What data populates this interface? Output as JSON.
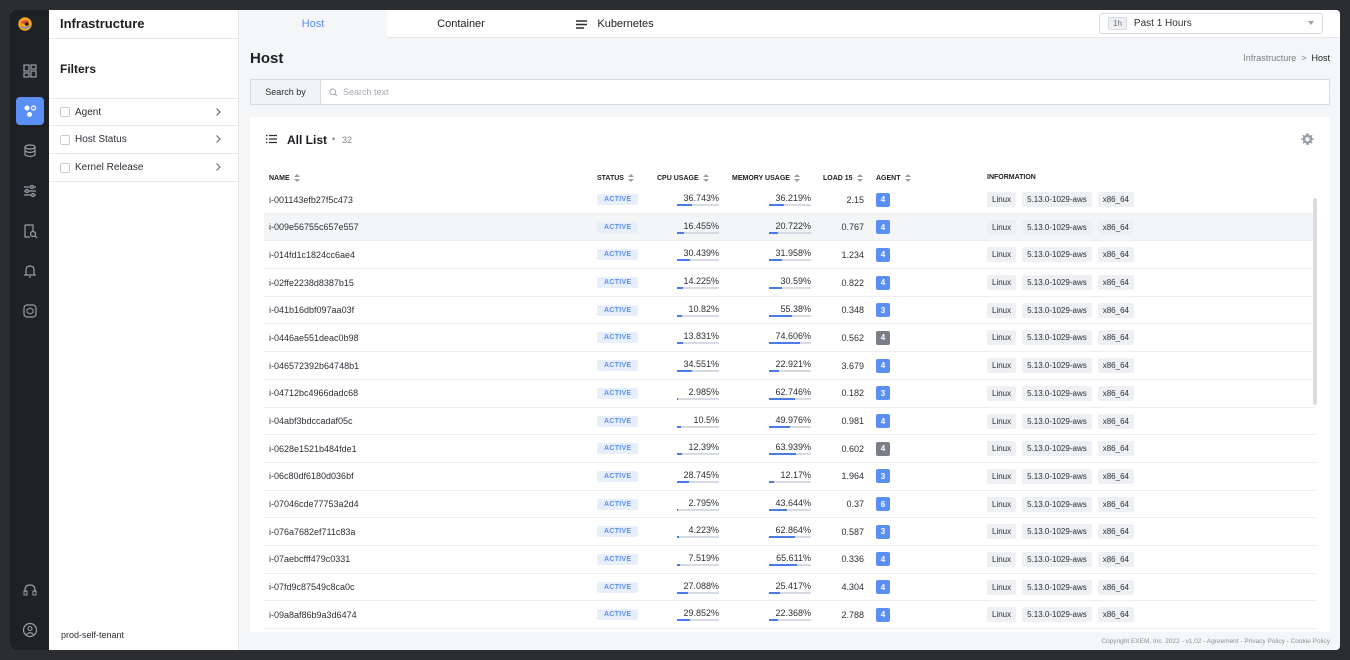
{
  "app": {
    "title": "Infrastructure"
  },
  "filters": {
    "title": "Filters",
    "items": [
      {
        "label": "Agent"
      },
      {
        "label": "Host Status"
      },
      {
        "label": "Kernel Release"
      }
    ],
    "tenant": "prod-self-tenant"
  },
  "tabs": [
    {
      "label": "Host",
      "active": true
    },
    {
      "label": "Container"
    },
    {
      "label": "Kubernetes"
    }
  ],
  "time": {
    "badge": "1h",
    "value": "Past 1 Hours"
  },
  "page": {
    "title": "Host"
  },
  "breadcrumb": {
    "parent": "Infrastructure",
    "separator": ">",
    "current": "Host"
  },
  "search": {
    "by_label": "Search by",
    "placeholder": "Search text",
    "value": ""
  },
  "list": {
    "title": "All List",
    "dot": "•",
    "count": "32"
  },
  "columns": {
    "name": "NAME",
    "status": "STATUS",
    "cpu": "CPU USAGE",
    "memory": "MEMORY USAGE",
    "load": "LOAD 15",
    "agent": "AGENT",
    "info": "INFORMATION"
  },
  "rows": [
    {
      "name": "i-001143efb27f5c473",
      "status": "ACTIVE",
      "cpu": "36.743%",
      "cpu_pct": 36.743,
      "mem": "36.219%",
      "mem_pct": 36.219,
      "load": "2.15",
      "agent": "4"
    },
    {
      "name": "i-009e56755c657e557",
      "status": "ACTIVE",
      "cpu": "16.455%",
      "cpu_pct": 16.455,
      "mem": "20.722%",
      "mem_pct": 20.722,
      "load": "0.767",
      "agent": "4"
    },
    {
      "name": "i-014fd1c1824cc6ae4",
      "status": "ACTIVE",
      "cpu": "30.439%",
      "cpu_pct": 30.439,
      "mem": "31.958%",
      "mem_pct": 31.958,
      "load": "1.234",
      "agent": "4"
    },
    {
      "name": "i-02ffe2238d8387b15",
      "status": "ACTIVE",
      "cpu": "14.225%",
      "cpu_pct": 14.225,
      "mem": "30.59%",
      "mem_pct": 30.59,
      "load": "0.822",
      "agent": "4"
    },
    {
      "name": "i-041b16dbf097aa03f",
      "status": "ACTIVE",
      "cpu": "10.82%",
      "cpu_pct": 10.82,
      "mem": "55.38%",
      "mem_pct": 55.38,
      "load": "0.348",
      "agent": "3"
    },
    {
      "name": "i-0446ae551deac0b98",
      "status": "ACTIVE",
      "cpu": "13.831%",
      "cpu_pct": 13.831,
      "mem": "74.606%",
      "mem_pct": 74.606,
      "load": "0.562",
      "agent": "4",
      "agent_grey": true
    },
    {
      "name": "i-046572392b64748b1",
      "status": "ACTIVE",
      "cpu": "34.551%",
      "cpu_pct": 34.551,
      "mem": "22.921%",
      "mem_pct": 22.921,
      "load": "3.679",
      "agent": "4"
    },
    {
      "name": "i-04712bc4966dadc68",
      "status": "ACTIVE",
      "cpu": "2.985%",
      "cpu_pct": 2.985,
      "mem": "62.746%",
      "mem_pct": 62.746,
      "load": "0.182",
      "agent": "3"
    },
    {
      "name": "i-04abf3bdccadaf05c",
      "status": "ACTIVE",
      "cpu": "10.5%",
      "cpu_pct": 10.5,
      "mem": "49.976%",
      "mem_pct": 49.976,
      "load": "0.981",
      "agent": "4"
    },
    {
      "name": "i-0628e1521b484fde1",
      "status": "ACTIVE",
      "cpu": "12.39%",
      "cpu_pct": 12.39,
      "mem": "63.939%",
      "mem_pct": 63.939,
      "load": "0.602",
      "agent": "4",
      "agent_grey": true
    },
    {
      "name": "i-06c80df6180d036bf",
      "status": "ACTIVE",
      "cpu": "28.745%",
      "cpu_pct": 28.745,
      "mem": "12.17%",
      "mem_pct": 12.17,
      "load": "1.964",
      "agent": "3"
    },
    {
      "name": "i-07046cde77753a2d4",
      "status": "ACTIVE",
      "cpu": "2.795%",
      "cpu_pct": 2.795,
      "mem": "43.644%",
      "mem_pct": 43.644,
      "load": "0.37",
      "agent": "6"
    },
    {
      "name": "i-076a7682ef711c83a",
      "status": "ACTIVE",
      "cpu": "4.223%",
      "cpu_pct": 4.223,
      "mem": "62.864%",
      "mem_pct": 62.864,
      "load": "0.587",
      "agent": "3"
    },
    {
      "name": "i-07aebcfff479c0331",
      "status": "ACTIVE",
      "cpu": "7.519%",
      "cpu_pct": 7.519,
      "mem": "65.611%",
      "mem_pct": 65.611,
      "load": "0.336",
      "agent": "4"
    },
    {
      "name": "i-07fd9c87549c8ca0c",
      "status": "ACTIVE",
      "cpu": "27.088%",
      "cpu_pct": 27.088,
      "mem": "25.417%",
      "mem_pct": 25.417,
      "load": "4.304",
      "agent": "4"
    },
    {
      "name": "i-09a8af86b9a3d6474",
      "status": "ACTIVE",
      "cpu": "29.852%",
      "cpu_pct": 29.852,
      "mem": "22.368%",
      "mem_pct": 22.368,
      "load": "2.788",
      "agent": "4"
    }
  ],
  "info_tags": {
    "os": "Linux",
    "kernel": "5.13.0-1029-aws",
    "arch": "x86_64"
  },
  "footer": "Copyright EXEM, Inc. 2022 - v1.02 - Agreement - Privacy Policy - Cookie Policy",
  "colors": {
    "accent": "#5b8ff5",
    "rail": "#1f2124",
    "agent_grey": "#7a7f87",
    "bar": "#4a7be8"
  }
}
